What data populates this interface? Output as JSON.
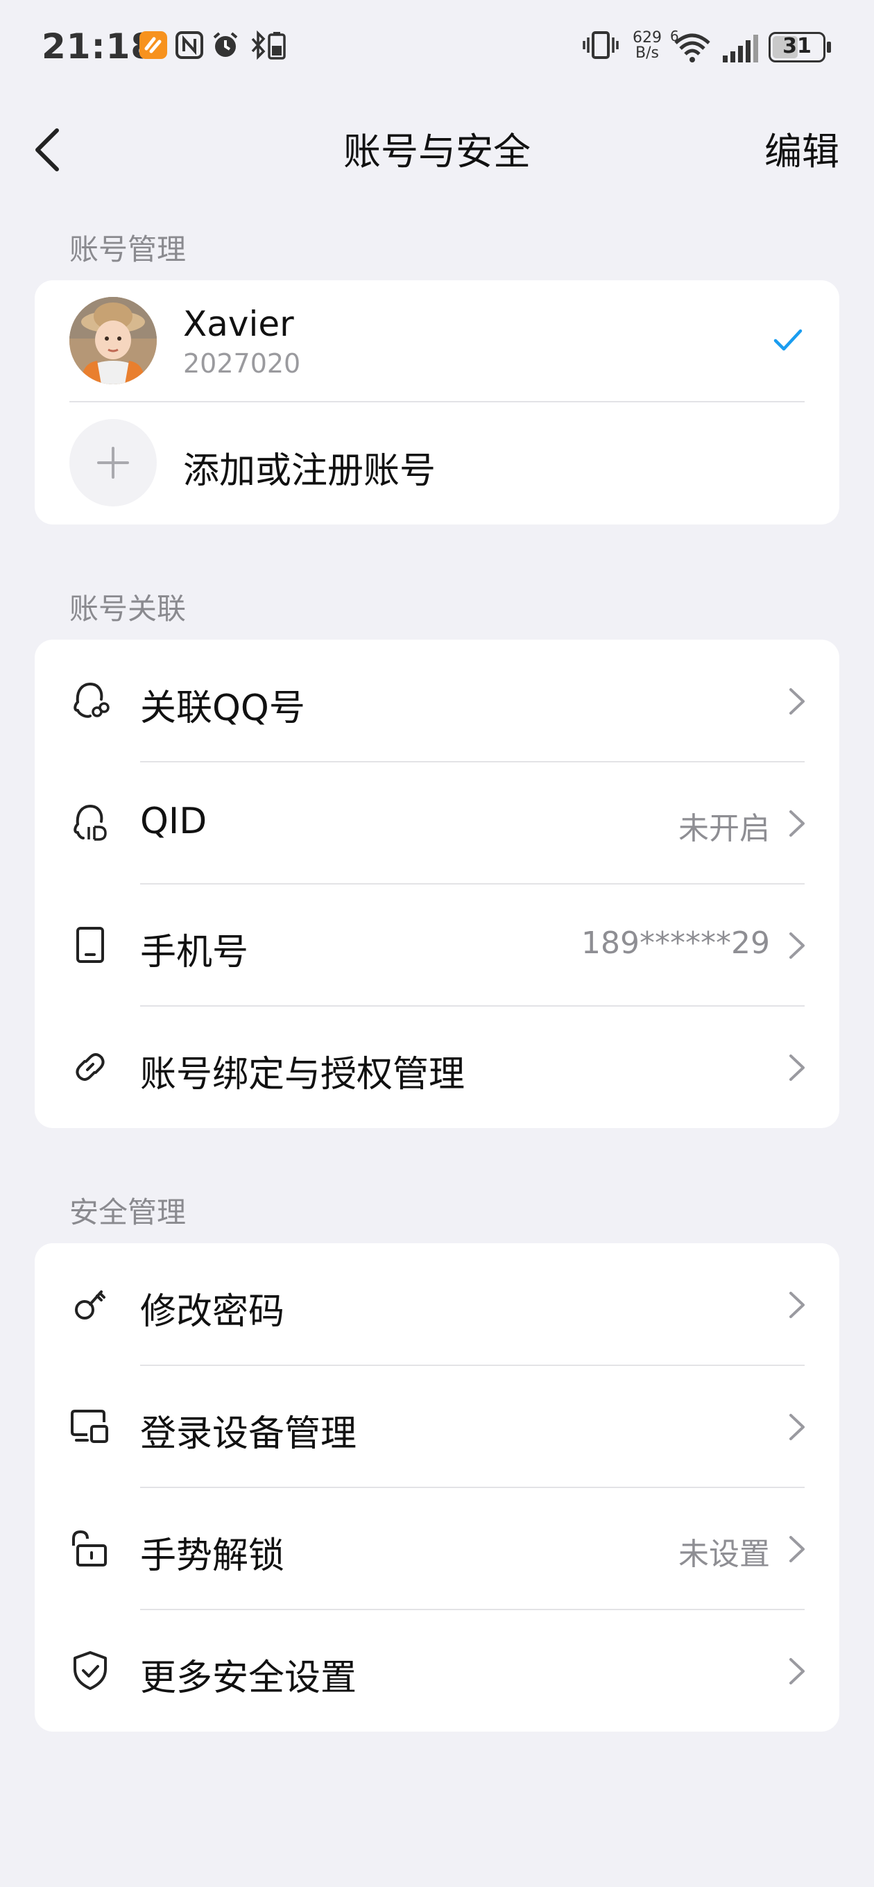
{
  "status_bar": {
    "time": "21:18",
    "net_speed_value": "629",
    "net_speed_unit": "B/s",
    "signal_type": "6",
    "battery": "31"
  },
  "header": {
    "title": "账号与安全",
    "edit_label": "编辑"
  },
  "account_section": {
    "label": "账号管理",
    "account": {
      "name": "Xavier",
      "id": "2027020"
    },
    "add_label": "添加或注册账号"
  },
  "link_section": {
    "label": "账号关联",
    "items": [
      {
        "label": "关联QQ号",
        "value": "",
        "icon": "qq-link-icon"
      },
      {
        "label": "QID",
        "value": "未开启",
        "icon": "qid-icon"
      },
      {
        "label": "手机号",
        "value": "189******29",
        "icon": "phone-icon"
      },
      {
        "label": "账号绑定与授权管理",
        "value": "",
        "icon": "link-icon"
      }
    ]
  },
  "security_section": {
    "label": "安全管理",
    "items": [
      {
        "label": "修改密码",
        "value": "",
        "icon": "key-icon"
      },
      {
        "label": "登录设备管理",
        "value": "",
        "icon": "devices-icon"
      },
      {
        "label": "手势解锁",
        "value": "未设置",
        "icon": "unlock-icon"
      },
      {
        "label": "更多安全设置",
        "value": "",
        "icon": "shield-icon"
      }
    ]
  },
  "colors": {
    "background": "#F1F1F6",
    "card": "#FFFFFF",
    "accent_check": "#1A9DF0",
    "secondary_text": "#8E8E93"
  }
}
